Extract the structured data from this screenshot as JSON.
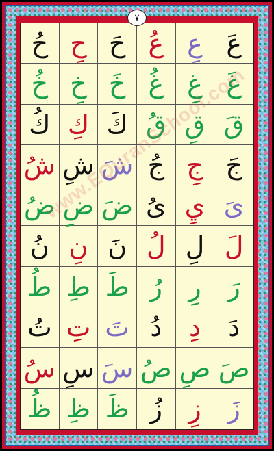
{
  "page_number": "٧",
  "watermark": "www.EQuranSchool.com",
  "colors": {
    "black": "#111111",
    "red": "#c8102e",
    "green": "#1aa04a",
    "purple": "#7b6bc4"
  },
  "rows": [
    [
      {
        "t": "عَ",
        "c": "black"
      },
      {
        "t": "عِ",
        "c": "purple"
      },
      {
        "t": "عُ",
        "c": "red"
      },
      {
        "t": "حَ",
        "c": "black"
      },
      {
        "t": "حِ",
        "c": "red"
      },
      {
        "t": "حُ",
        "c": "black"
      }
    ],
    [
      {
        "t": "غَ",
        "c": "green"
      },
      {
        "t": "غِ",
        "c": "green"
      },
      {
        "t": "غُ",
        "c": "green"
      },
      {
        "t": "خَ",
        "c": "green"
      },
      {
        "t": "خِ",
        "c": "green"
      },
      {
        "t": "خُ",
        "c": "green"
      }
    ],
    [
      {
        "t": "قَ",
        "c": "green"
      },
      {
        "t": "قِ",
        "c": "green"
      },
      {
        "t": "قُ",
        "c": "green"
      },
      {
        "t": "كَ",
        "c": "black"
      },
      {
        "t": "كِ",
        "c": "red"
      },
      {
        "t": "كُ",
        "c": "black"
      }
    ],
    [
      {
        "t": "جَ",
        "c": "black"
      },
      {
        "t": "جِ",
        "c": "red"
      },
      {
        "t": "جُ",
        "c": "black"
      },
      {
        "t": "شَ",
        "c": "purple"
      },
      {
        "t": "شِ",
        "c": "black"
      },
      {
        "t": "شُ",
        "c": "red"
      }
    ],
    [
      {
        "t": "ىَ",
        "c": "purple"
      },
      {
        "t": "يِ",
        "c": "red"
      },
      {
        "t": "ىُ",
        "c": "black"
      },
      {
        "t": "ضَ",
        "c": "green"
      },
      {
        "t": "ضِ",
        "c": "green"
      },
      {
        "t": "ضُ",
        "c": "green"
      }
    ],
    [
      {
        "t": "لَ",
        "c": "red"
      },
      {
        "t": "لِ",
        "c": "black"
      },
      {
        "t": "لُ",
        "c": "red"
      },
      {
        "t": "نَ",
        "c": "black"
      },
      {
        "t": "نِ",
        "c": "red"
      },
      {
        "t": "نُ",
        "c": "black"
      }
    ],
    [
      {
        "t": "رَ",
        "c": "green"
      },
      {
        "t": "رِ",
        "c": "green"
      },
      {
        "t": "رُ",
        "c": "green"
      },
      {
        "t": "طَ",
        "c": "green"
      },
      {
        "t": "طِ",
        "c": "green"
      },
      {
        "t": "طُ",
        "c": "green"
      }
    ],
    [
      {
        "t": "دَ",
        "c": "black"
      },
      {
        "t": "دِ",
        "c": "red"
      },
      {
        "t": "دُ",
        "c": "black"
      },
      {
        "t": "تَ",
        "c": "purple"
      },
      {
        "t": "تِ",
        "c": "red"
      },
      {
        "t": "تُ",
        "c": "black"
      }
    ],
    [
      {
        "t": "صَ",
        "c": "green"
      },
      {
        "t": "صِ",
        "c": "green"
      },
      {
        "t": "صُ",
        "c": "green"
      },
      {
        "t": "سَ",
        "c": "purple"
      },
      {
        "t": "سِ",
        "c": "black"
      },
      {
        "t": "سُ",
        "c": "red"
      }
    ],
    [
      {
        "t": "زَ",
        "c": "purple"
      },
      {
        "t": "زِ",
        "c": "red"
      },
      {
        "t": "زُ",
        "c": "black"
      },
      {
        "t": "ظَ",
        "c": "green"
      },
      {
        "t": "ظِ",
        "c": "green"
      },
      {
        "t": "ظُ",
        "c": "green"
      }
    ]
  ]
}
